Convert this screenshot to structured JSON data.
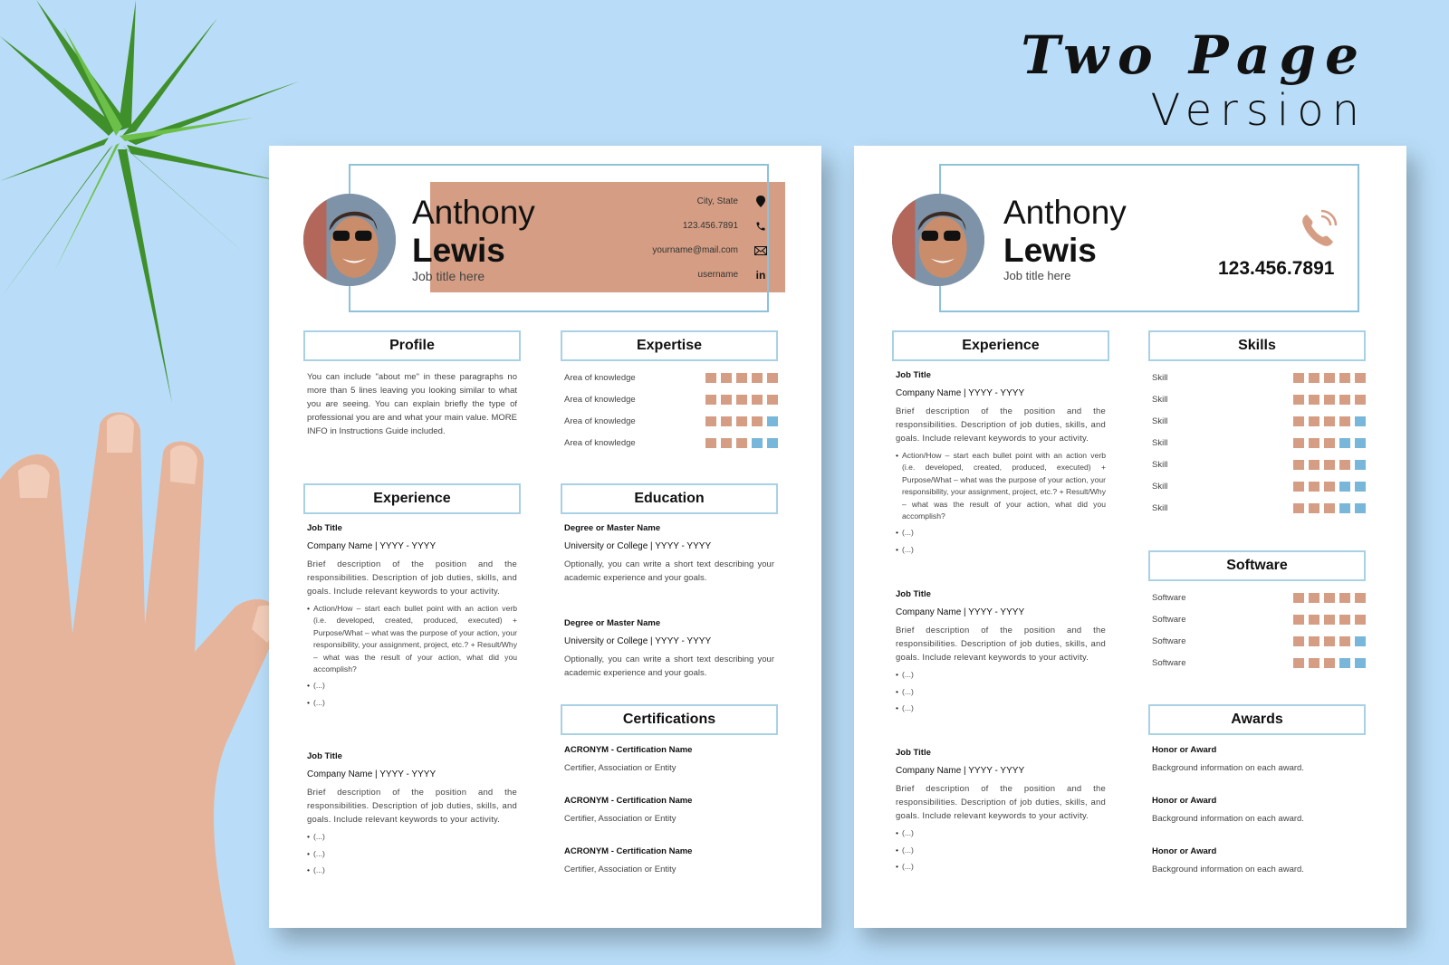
{
  "headline": {
    "line1": "Two Page",
    "line2": "Version"
  },
  "colors": {
    "accent_band": "#d59e84",
    "frame_blue": "#8dc1dc",
    "rating_filled": "#d59e84",
    "rating_empty": "#79b7da",
    "background": "#b9ddf8"
  },
  "page1": {
    "header": {
      "first_name": "Anthony",
      "last_name": "Lewis",
      "job_title": "Job title here",
      "contacts": [
        {
          "text": "City, State",
          "icon": "location-pin-icon"
        },
        {
          "text": "123.456.7891",
          "icon": "phone-icon"
        },
        {
          "text": "yourname@mail.com",
          "icon": "envelope-icon"
        },
        {
          "text": "username",
          "icon": "linkedin-icon",
          "glyph": "in"
        }
      ]
    },
    "profile": {
      "title": "Profile",
      "text": "You can include \"about me\" in these paragraphs no more than 5 lines leaving you looking similar to what you are seeing. You can explain briefly the type of professional you are and what your main value. MORE INFO in Instructions Guide included."
    },
    "expertise": {
      "title": "Expertise",
      "items": [
        {
          "label": "Area of knowledge",
          "level": 5,
          "max": 5
        },
        {
          "label": "Area of knowledge",
          "level": 5,
          "max": 5
        },
        {
          "label": "Area of knowledge",
          "level": 4,
          "max": 5
        },
        {
          "label": "Area of knowledge",
          "level": 3,
          "max": 5
        }
      ]
    },
    "experience": {
      "title": "Experience",
      "jobs": [
        {
          "title": "Job Title",
          "company": "Company Name | YYYY - YYYY",
          "description": "Brief description of the position and the responsibilities. Description of job duties, skills, and goals. Include relevant keywords to your activity.",
          "bullets": [
            "Action/How – start each bullet point with an action verb (i.e. developed, created, produced, executed) + Purpose/What – what was the purpose of your action, your responsibility, your assignment, project, etc.? + Result/Why – what was the result of your action, what did you accomplish?",
            "(...)",
            "(...)"
          ]
        },
        {
          "title": "Job Title",
          "company": "Company Name | YYYY - YYYY",
          "description": "Brief description of the position and the responsibilities. Description of job duties, skills, and goals. Include relevant keywords to your activity.",
          "bullets": [
            "(...)",
            "(...)",
            "(...)"
          ]
        }
      ]
    },
    "education": {
      "title": "Education",
      "items": [
        {
          "degree": "Degree or Master Name",
          "school": "University or College | YYYY - YYYY",
          "text": "Optionally, you can write a short text describing your academic experience and your goals."
        },
        {
          "degree": "Degree or Master Name",
          "school": "University or College | YYYY - YYYY",
          "text": "Optionally, you can write a short text describing your academic experience and your goals."
        }
      ]
    },
    "certifications": {
      "title": "Certifications",
      "items": [
        {
          "name": "ACRONYM - Certification Name",
          "issuer": "Certifier, Association or Entity"
        },
        {
          "name": "ACRONYM - Certification Name",
          "issuer": "Certifier, Association or Entity"
        },
        {
          "name": "ACRONYM - Certification Name",
          "issuer": "Certifier, Association or Entity"
        }
      ]
    }
  },
  "page2": {
    "header": {
      "first_name": "Anthony",
      "last_name": "Lewis",
      "job_title": "Job title here",
      "phone": "123.456.7891"
    },
    "experience": {
      "title": "Experience",
      "jobs": [
        {
          "title": "Job Title",
          "company": "Company Name | YYYY - YYYY",
          "description": "Brief description of the position and the responsibilities. Description of job duties, skills, and goals. Include relevant keywords to your activity.",
          "bullets": [
            "Action/How – start each bullet point with an action verb (i.e. developed, created, produced, executed) + Purpose/What – what was the purpose of your action, your responsibility, your assignment, project, etc.? + Result/Why – what was the result of your action, what did you accomplish?",
            "(...)",
            "(...)"
          ]
        },
        {
          "title": "Job Title",
          "company": "Company Name | YYYY - YYYY",
          "description": "Brief description of the position and the responsibilities. Description of job duties, skills, and goals. Include relevant keywords to your activity.",
          "bullets": [
            "(...)",
            "(...)",
            "(...)"
          ]
        },
        {
          "title": "Job Title",
          "company": "Company Name | YYYY - YYYY",
          "description": "Brief description of the position and the responsibilities. Description of job duties, skills, and goals. Include relevant keywords to your activity.",
          "bullets": [
            "(...)",
            "(...)",
            "(...)"
          ]
        }
      ]
    },
    "skills": {
      "title": "Skills",
      "items": [
        {
          "label": "Skill",
          "level": 5,
          "max": 5
        },
        {
          "label": "Skill",
          "level": 5,
          "max": 5
        },
        {
          "label": "Skill",
          "level": 4,
          "max": 5
        },
        {
          "label": "Skill",
          "level": 3,
          "max": 5
        },
        {
          "label": "Skill",
          "level": 4,
          "max": 5
        },
        {
          "label": "Skill",
          "level": 3,
          "max": 5
        },
        {
          "label": "Skill",
          "level": 3,
          "max": 5
        }
      ]
    },
    "software": {
      "title": "Software",
      "items": [
        {
          "label": "Software",
          "level": 5,
          "max": 5
        },
        {
          "label": "Software",
          "level": 5,
          "max": 5
        },
        {
          "label": "Software",
          "level": 4,
          "max": 5
        },
        {
          "label": "Software",
          "level": 3,
          "max": 5
        }
      ]
    },
    "awards": {
      "title": "Awards",
      "items": [
        {
          "name": "Honor or Award",
          "text": "Background information on each award."
        },
        {
          "name": "Honor or Award",
          "text": "Background information on each award."
        },
        {
          "name": "Honor or Award",
          "text": "Background information on each award."
        }
      ]
    }
  }
}
